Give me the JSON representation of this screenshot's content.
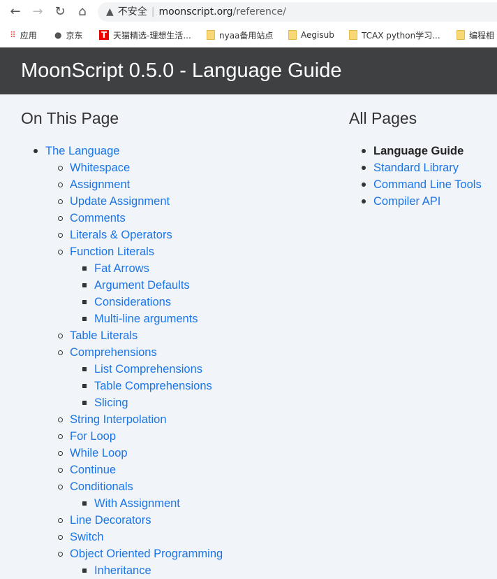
{
  "browser": {
    "security_label": "不安全",
    "url_host": "moonscript.org",
    "url_path": "/reference/",
    "bookmarks": [
      {
        "label": "应用",
        "icon": "apps-grid-icon"
      },
      {
        "label": "京东",
        "icon": "globe-icon"
      },
      {
        "label": "天猫精选-理想生活...",
        "icon": "tmall-icon"
      },
      {
        "label": "nyaa备用站点",
        "icon": "folder-icon"
      },
      {
        "label": "Aegisub",
        "icon": "folder-icon"
      },
      {
        "label": "TCAX python学习...",
        "icon": "folder-icon"
      },
      {
        "label": "编程相",
        "icon": "folder-icon"
      }
    ]
  },
  "header": {
    "title": "MoonScript 0.5.0 - Language Guide"
  },
  "on_this_page": {
    "heading": "On This Page",
    "items": [
      {
        "label": "The Language",
        "children": [
          {
            "label": "Whitespace"
          },
          {
            "label": "Assignment"
          },
          {
            "label": "Update Assignment"
          },
          {
            "label": "Comments"
          },
          {
            "label": "Literals & Operators"
          },
          {
            "label": "Function Literals",
            "children": [
              {
                "label": "Fat Arrows"
              },
              {
                "label": "Argument Defaults"
              },
              {
                "label": "Considerations"
              },
              {
                "label": "Multi-line arguments"
              }
            ]
          },
          {
            "label": "Table Literals"
          },
          {
            "label": "Comprehensions",
            "children": [
              {
                "label": "List Comprehensions"
              },
              {
                "label": "Table Comprehensions"
              },
              {
                "label": "Slicing"
              }
            ]
          },
          {
            "label": "String Interpolation"
          },
          {
            "label": "For Loop"
          },
          {
            "label": "While Loop"
          },
          {
            "label": "Continue"
          },
          {
            "label": "Conditionals",
            "children": [
              {
                "label": "With Assignment"
              }
            ]
          },
          {
            "label": "Line Decorators"
          },
          {
            "label": "Switch"
          },
          {
            "label": "Object Oriented Programming",
            "children": [
              {
                "label": "Inheritance"
              }
            ]
          }
        ]
      }
    ]
  },
  "all_pages": {
    "heading": "All Pages",
    "items": [
      {
        "label": "Language Guide",
        "current": true
      },
      {
        "label": "Standard Library"
      },
      {
        "label": "Command Line Tools"
      },
      {
        "label": "Compiler API"
      }
    ]
  }
}
